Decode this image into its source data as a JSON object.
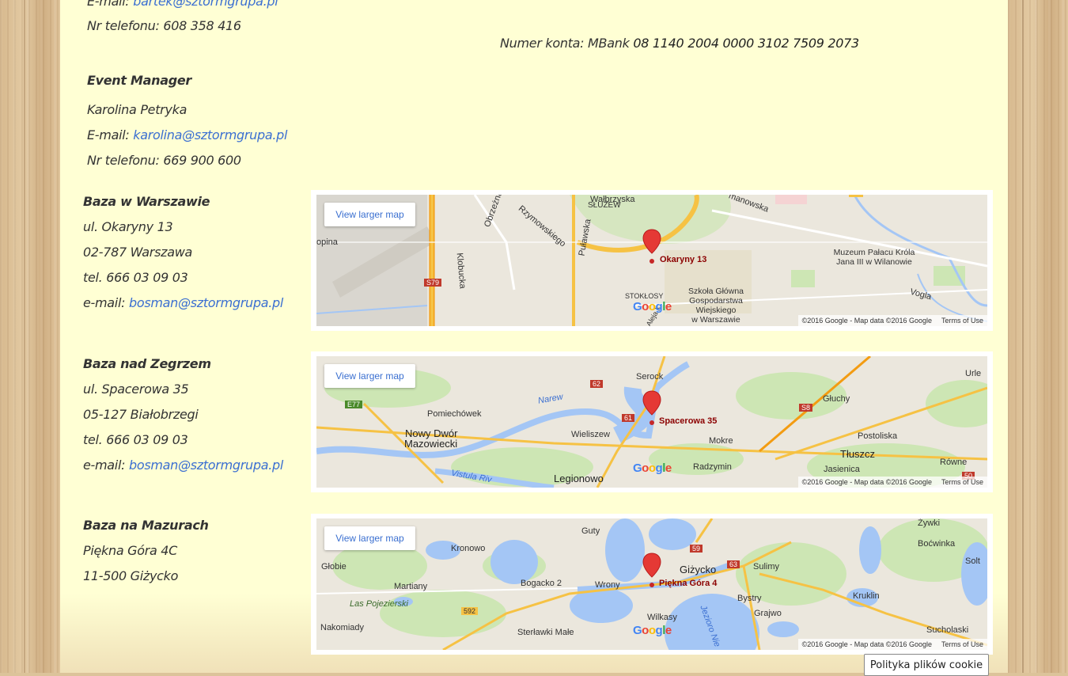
{
  "top_contact": {
    "email_label": "E-mail: ",
    "email": "bartek@sztormgrupa.pl",
    "phone": "Nr telefonu: 608 358 416"
  },
  "bank": {
    "label": "Numer konta: MBank ",
    "number": "08 1140 2004 0000 3102 7509 2073"
  },
  "event_manager": {
    "heading": "Event Manager",
    "name": "Karolina Petryka",
    "email_label": "E-mail: ",
    "email": "karolina@sztormgrupa.pl",
    "phone": "Nr telefonu: 669 900 600"
  },
  "bases": [
    {
      "title": "Baza w Warszawie",
      "street": "ul. Okaryny 13",
      "city": "02-787 Warszawa",
      "tel": "tel. 666 03 09 03",
      "email_label": "e-mail: ",
      "email": "bosman@sztormgrupa.pl",
      "map": {
        "pin_label": "Okaryny 13",
        "places": [
          "Wałbrzyska",
          "Rzymowskiego",
          "SŁUŻEW",
          "Puławska",
          "Obrzeżna",
          "Klobucka",
          "opina",
          "S79",
          "Muzeum Pałacu Króla",
          "Jana III w Wilanowie",
          "Szkoła Główna",
          "Gospodarstwa",
          "Wiejskiego",
          "w Warszawie",
          "STOKŁOSY",
          "Aleja K",
          "Vogla",
          "manowska"
        ]
      }
    },
    {
      "title": "Baza nad Zegrzem",
      "street": "ul. Spacerowa 35",
      "city": "05-127 Białobrzegi",
      "tel": "tel. 666 03 09 03",
      "email_label": "e-mail: ",
      "email": "bosman@sztormgrupa.pl",
      "map": {
        "pin_label": "Spacerowa 35",
        "places": [
          "Serock",
          "Urle",
          "Głuchy",
          "Pomiechówek",
          "Narew",
          "Nowy Dwór",
          "Mazowiecki",
          "Wieliszew",
          "Mokre",
          "Postoliska",
          "Tłuszcz",
          "Legionowo",
          "Radzymin",
          "Jasienica",
          "Równe",
          "Vistula Riv",
          "E77",
          "62",
          "61",
          "S8",
          "50"
        ]
      }
    },
    {
      "title": "Baza na Mazurach",
      "street": "Piękna Góra 4C",
      "city": "11-500 Giżycko",
      "map": {
        "pin_label": "Piękna Góra 4",
        "places": [
          "Guty",
          "Żywki",
          "Kronowo",
          "Boćwinka",
          "Głobie",
          "Giżycko",
          "Sulimy",
          "Solt",
          "Martiany",
          "Bogacko 2",
          "Wrony",
          "Bystry",
          "Kruklin",
          "Las Pojezierski",
          "Wilkasy",
          "Grajwo",
          "Jezioro Nie",
          "Nakomiady",
          "Sterławki Małe",
          "Sucholaski",
          "59",
          "63",
          "592"
        ]
      }
    }
  ],
  "map_common": {
    "view_larger": "View larger map",
    "copyright": "©2016 Google - Map data ©2016 Google",
    "terms": "Terms of Use",
    "logo": [
      "G",
      "o",
      "o",
      "g",
      "l",
      "e"
    ]
  },
  "cookie": "Polityka plików cookie",
  "colors": {
    "page_bg": "#ffffd4",
    "link": "#3b6fd1",
    "text": "#333333",
    "pin": "#e53935",
    "water": "#a4c6f5",
    "road_major": "#f6c244",
    "park": "#cde6b4"
  }
}
